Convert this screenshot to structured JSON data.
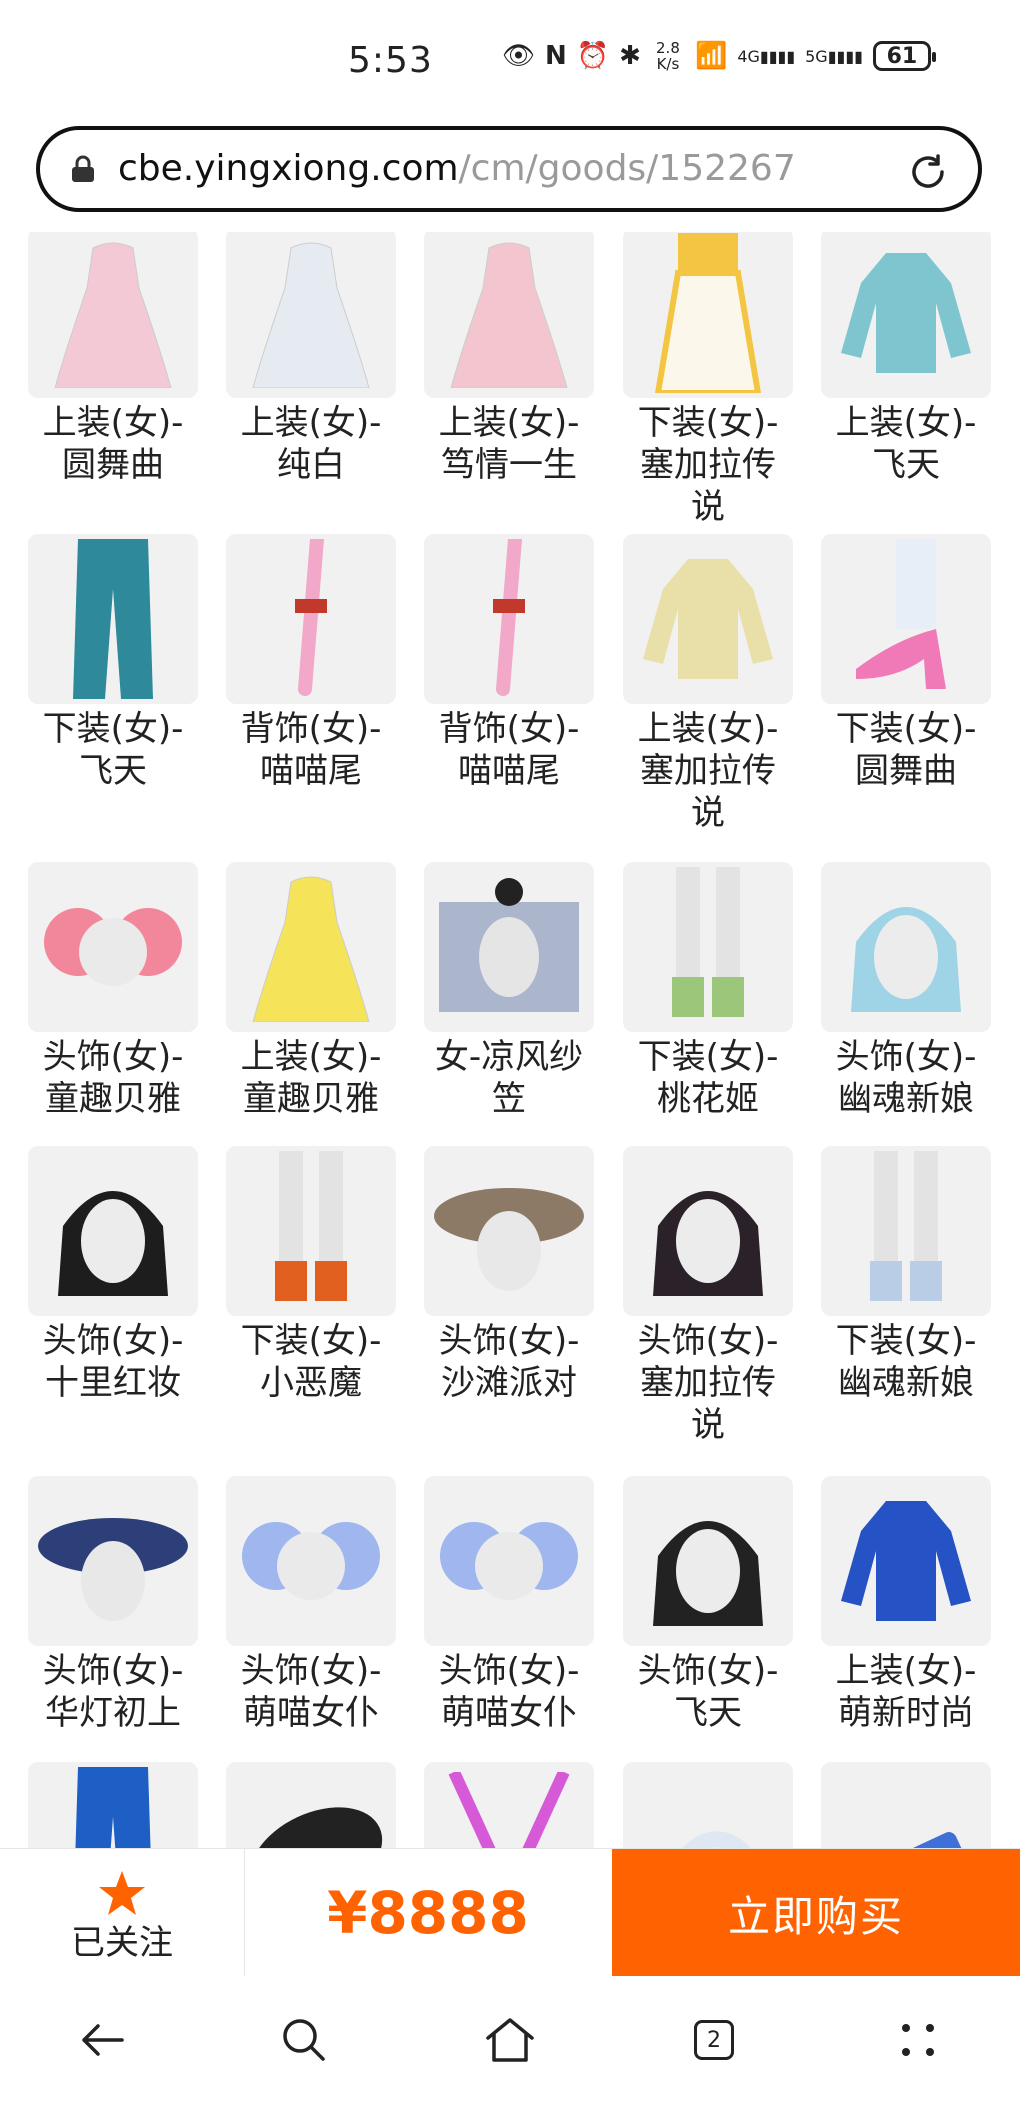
{
  "status": {
    "time": "5:53",
    "speed_top": "2.8",
    "speed_bottom": "K/s",
    "network1": "4G",
    "network2": "5G",
    "battery": "61"
  },
  "browser": {
    "url_host": "cbe.yingxiong.com",
    "url_path": "/cm/goods/152267"
  },
  "items": [
    {
      "line1": "上装(女)-",
      "line2": "圆舞曲",
      "art": "dress",
      "color": "#f2c9d4"
    },
    {
      "line1": "上装(女)-",
      "line2": "纯白",
      "art": "dress",
      "color": "#e6ebf2"
    },
    {
      "line1": "上装(女)-",
      "line2": "笃情一生",
      "art": "dress",
      "color": "#f3c6cf"
    },
    {
      "line1": "下装(女)-",
      "line2": "塞加拉传说",
      "art": "skirt",
      "color": "#f4c542"
    },
    {
      "line1": "上装(女)-",
      "line2": "飞天",
      "art": "top",
      "color": "#7fc5cf"
    },
    {
      "line1": "下装(女)-",
      "line2": "飞天",
      "art": "pants",
      "color": "#2e8a9a"
    },
    {
      "line1": "背饰(女)-",
      "line2": "喵喵尾",
      "art": "tail",
      "color": "#f2a8c8"
    },
    {
      "line1": "背饰(女)-",
      "line2": "喵喵尾",
      "art": "tail",
      "color": "#f2a8c8"
    },
    {
      "line1": "上装(女)-",
      "line2": "塞加拉传说",
      "art": "top",
      "color": "#e9dfa8"
    },
    {
      "line1": "下装(女)-",
      "line2": "圆舞曲",
      "art": "heel",
      "color": "#f07ab7"
    },
    {
      "line1": "头饰(女)-",
      "line2": "童趣贝雅",
      "art": "hair",
      "color": "#f2879b"
    },
    {
      "line1": "上装(女)-",
      "line2": "童趣贝雅",
      "art": "dress",
      "color": "#f5e35a"
    },
    {
      "line1": "女-凉风纱",
      "line2": "笠",
      "art": "veil",
      "color": "#9aa7c4"
    },
    {
      "line1": "下装(女)-",
      "line2": "桃花姬",
      "art": "legs",
      "color": "#9cc77a"
    },
    {
      "line1": "头饰(女)-",
      "line2": "幽魂新娘",
      "art": "head",
      "color": "#9fd4e6"
    },
    {
      "line1": "头饰(女)-",
      "line2": "十里红妆",
      "art": "head",
      "color": "#1d1d1d"
    },
    {
      "line1": "下装(女)-",
      "line2": "小恶魔",
      "art": "legs",
      "color": "#e2601f"
    },
    {
      "line1": "头饰(女)-",
      "line2": "沙滩派对",
      "art": "hat",
      "color": "#8c7a66"
    },
    {
      "line1": "头饰(女)-",
      "line2": "塞加拉传说",
      "art": "head",
      "color": "#2a2228"
    },
    {
      "line1": "下装(女)-",
      "line2": "幽魂新娘",
      "art": "legs",
      "color": "#b9cde6"
    },
    {
      "line1": "头饰(女)-",
      "line2": "华灯初上",
      "art": "hat",
      "color": "#2d3f78"
    },
    {
      "line1": "头饰(女)-",
      "line2": "萌喵女仆",
      "art": "hair",
      "color": "#9fb6ef"
    },
    {
      "line1": "头饰(女)-",
      "line2": "萌喵女仆",
      "art": "hair",
      "color": "#9fb6ef"
    },
    {
      "line1": "头饰(女)-",
      "line2": "飞天",
      "art": "head",
      "color": "#222"
    },
    {
      "line1": "上装(女)-",
      "line2": "萌新时尚",
      "art": "top",
      "color": "#2552c4"
    },
    {
      "line1": "",
      "line2": "",
      "art": "pants",
      "color": "#1d5fc4"
    },
    {
      "line1": "",
      "line2": "",
      "art": "mouse",
      "color": "#222"
    },
    {
      "line1": "",
      "line2": "",
      "art": "rods",
      "color": "#d65ad8"
    },
    {
      "line1": "",
      "line2": "",
      "art": "wisp",
      "color": "#dfe7f2"
    },
    {
      "line1": "",
      "line2": "",
      "art": "keyboard",
      "color": "#3f6fd8"
    }
  ],
  "bottom": {
    "follow_label": "已关注",
    "price": "¥8888",
    "buy_label": "立即购买",
    "accent": "#ff6200"
  },
  "nav": {
    "tab_count": "2",
    "icons": [
      "back-arrow-icon",
      "search-icon",
      "home-icon",
      "tabs-icon",
      "more-icon"
    ]
  }
}
